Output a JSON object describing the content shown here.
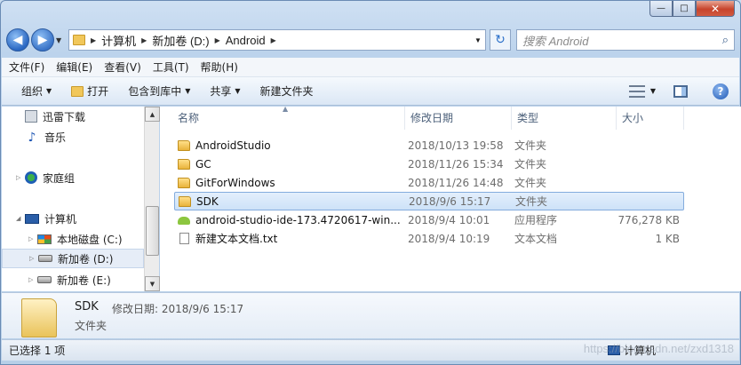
{
  "window": {
    "minimize": "—",
    "maximize": "□",
    "close": "✕"
  },
  "address": {
    "segments": [
      "计算机",
      "新加卷 (D:)",
      "Android"
    ],
    "search_placeholder": "搜索 Android"
  },
  "menubar": [
    "文件(F)",
    "编辑(E)",
    "查看(V)",
    "工具(T)",
    "帮助(H)"
  ],
  "toolbar": {
    "organize": "组织",
    "open": "打开",
    "include": "包含到库中",
    "share": "共享",
    "new_folder": "新建文件夹"
  },
  "navpane": {
    "xunlei": "迅雷下载",
    "music": "音乐",
    "homegroup": "家庭组",
    "computer": "计算机",
    "drive_c": "本地磁盘 (C:)",
    "drive_d": "新加卷 (D:)",
    "drive_e": "新加卷 (E:)"
  },
  "columns": {
    "name": "名称",
    "date": "修改日期",
    "type": "类型",
    "size": "大小"
  },
  "files": [
    {
      "name": "AndroidStudio",
      "date": "2018/10/13 19:58",
      "type": "文件夹",
      "size": "",
      "icon": "folder-icon"
    },
    {
      "name": "GC",
      "date": "2018/11/26 15:34",
      "type": "文件夹",
      "size": "",
      "icon": "folder-icon"
    },
    {
      "name": "GitForWindows",
      "date": "2018/11/26 14:48",
      "type": "文件夹",
      "size": "",
      "icon": "folder-icon"
    },
    {
      "name": "SDK",
      "date": "2018/9/6 15:17",
      "type": "文件夹",
      "size": "",
      "icon": "folder-icon"
    },
    {
      "name": "android-studio-ide-173.4720617-win...",
      "date": "2018/9/4 10:01",
      "type": "应用程序",
      "size": "776,278 KB",
      "icon": "android-exe-icon"
    },
    {
      "name": "新建文本文档.txt",
      "date": "2018/9/4 10:19",
      "type": "文本文档",
      "size": "1 KB",
      "icon": "text-file-icon"
    }
  ],
  "details": {
    "name": "SDK",
    "modified_label": "修改日期:",
    "modified": "2018/9/6 15:17",
    "type": "文件夹"
  },
  "status": {
    "selected": "已选择 1 项",
    "location": "计算机"
  },
  "watermark": "https://blog.csdn.net/zxd1318"
}
